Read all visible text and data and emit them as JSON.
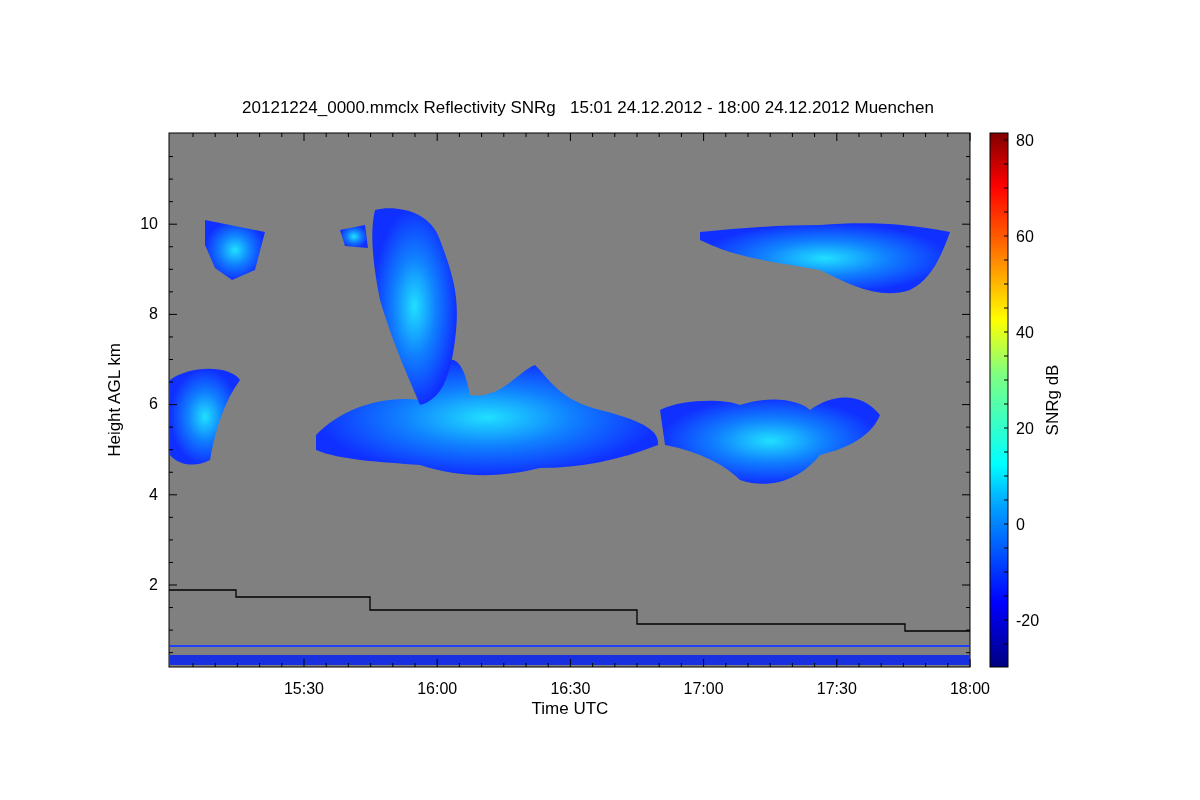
{
  "title": "20121224_0000.mmclx Reflectivity SNRg   15:01 24.12.2012 - 18:00 24.12.2012 Muenchen",
  "y_axis": {
    "label": "Height AGL km",
    "ticks": [
      "10",
      "8",
      "6",
      "4",
      "2"
    ]
  },
  "x_axis": {
    "label": "Time UTC",
    "ticks": [
      "15:30",
      "16:00",
      "16:30",
      "17:00",
      "17:30",
      "18:00"
    ]
  },
  "colorbar": {
    "label": "SNRg dB",
    "ticks": [
      "80",
      "60",
      "40",
      "20",
      "0",
      "-20"
    ]
  }
}
